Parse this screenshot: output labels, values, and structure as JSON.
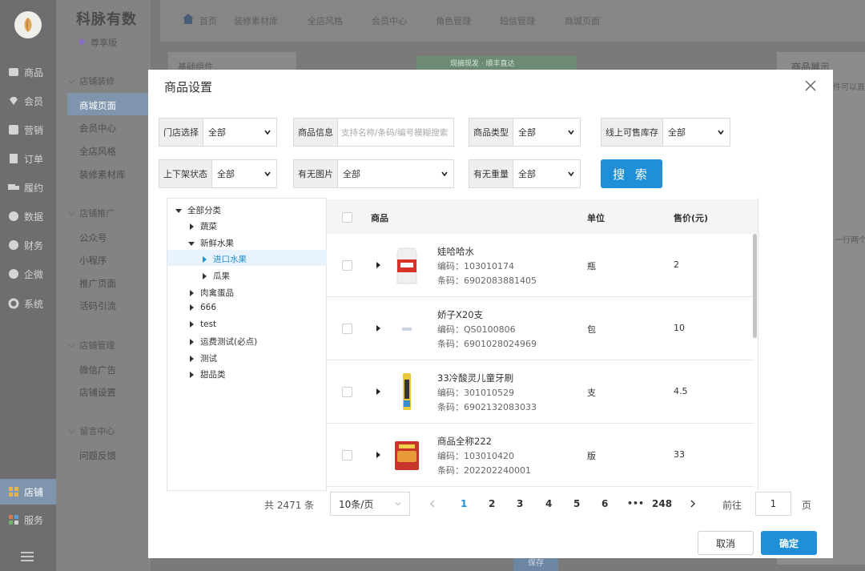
{
  "brand": {
    "name": "科脉有数",
    "edition": "尊享版"
  },
  "rail": {
    "items": [
      {
        "label": "商品",
        "icon": "goods-icon"
      },
      {
        "label": "会员",
        "icon": "member-icon"
      },
      {
        "label": "营销",
        "icon": "marketing-icon"
      },
      {
        "label": "订单",
        "icon": "order-icon"
      },
      {
        "label": "履约",
        "icon": "delivery-icon"
      },
      {
        "label": "数据",
        "icon": "data-icon"
      },
      {
        "label": "财务",
        "icon": "finance-icon"
      },
      {
        "label": "企微",
        "icon": "wecom-icon"
      },
      {
        "label": "系统",
        "icon": "system-icon"
      }
    ],
    "store": "店铺",
    "service": "服务"
  },
  "sidebar": {
    "sections": [
      {
        "title": "店铺装修",
        "items": [
          "商城页面",
          "会员中心",
          "全店风格",
          "装修素材库"
        ]
      },
      {
        "title": "店铺推广",
        "items": [
          "公众号",
          "小程序",
          "推广页面",
          "活码引流"
        ]
      },
      {
        "title": "店铺管理",
        "items": [
          "微信广告",
          "店铺设置"
        ]
      },
      {
        "title": "留言中心",
        "items": [
          "问题反馈"
        ]
      }
    ]
  },
  "topnav": {
    "home": "首页",
    "tabs": [
      "装修素材库",
      "全店风格",
      "会员中心",
      "角色管理",
      "短信管理",
      "商城页面"
    ]
  },
  "background": {
    "left_panel_title": "基础组件",
    "right_panel_title": "商品展示",
    "right_panel_hint": "件可以直接",
    "right_row_hint": "一行两个",
    "banner_text": "现摘现发 · 顺丰直达",
    "save": "保存"
  },
  "modal": {
    "title": "商品设置",
    "filters": {
      "store": {
        "label": "门店选择",
        "value": "全部"
      },
      "info": {
        "label": "商品信息",
        "placeholder": "支持名称/条码/编号模糊搜索"
      },
      "type": {
        "label": "商品类型",
        "value": "全部"
      },
      "stock": {
        "label": "线上可售库存",
        "value": "全部"
      },
      "shelf": {
        "label": "上下架状态",
        "value": "全部"
      },
      "image": {
        "label": "有无图片",
        "value": "全部"
      },
      "weight": {
        "label": "有无重量",
        "value": "全部"
      }
    },
    "search_label": "搜 索",
    "tree": {
      "root": "全部分类",
      "nodes": [
        {
          "label": "蔬菜",
          "level": 1,
          "state": "collapsed"
        },
        {
          "label": "新鲜水果",
          "level": 1,
          "state": "expanded"
        },
        {
          "label": "进口水果",
          "level": 2,
          "state": "collapsed",
          "selected": true
        },
        {
          "label": "瓜果",
          "level": 2,
          "state": "collapsed"
        },
        {
          "label": "肉禽蛋品",
          "level": 1,
          "state": "collapsed"
        },
        {
          "label": "666",
          "level": 1,
          "state": "collapsed"
        },
        {
          "label": "test",
          "level": 1,
          "state": "collapsed"
        },
        {
          "label": "运费测试(必点)",
          "level": 1,
          "state": "collapsed"
        },
        {
          "label": "测试",
          "level": 1,
          "state": "collapsed"
        },
        {
          "label": "甜品类",
          "level": 1,
          "state": "collapsed"
        }
      ]
    },
    "table": {
      "headers": {
        "product": "商品",
        "unit": "单位",
        "price": "售价(元)"
      },
      "rows": [
        {
          "name": "娃哈哈水",
          "code": "编码：103010174",
          "barcode": "条码：6902083881405",
          "unit": "瓶",
          "price": "2",
          "thumb": "water-bottle-image"
        },
        {
          "name": "娇子X20支",
          "code": "编码：QS0100806",
          "barcode": "条码：6901028024969",
          "unit": "包",
          "price": "10",
          "thumb": "cigarette-image"
        },
        {
          "name": "33冷酸灵儿童牙刷",
          "code": "编码：301010529",
          "barcode": "条码：6902132083033",
          "unit": "支",
          "price": "4.5",
          "thumb": "toothbrush-image"
        },
        {
          "name": "商品全称222",
          "code": "编码：103010420",
          "barcode": "条码：202202240001",
          "unit": "版",
          "price": "33",
          "thumb": "snack-bag-image"
        }
      ]
    },
    "pagination": {
      "total": "共 2471 条",
      "page_size": "10条/页",
      "pages": [
        "1",
        "2",
        "3",
        "4",
        "5",
        "6"
      ],
      "ellipsis": "•••",
      "last": "248",
      "current": "1",
      "goto": "前往",
      "goto_value": "1",
      "page_unit": "页"
    },
    "buttons": {
      "cancel": "取消",
      "confirm": "确定"
    }
  },
  "colors": {
    "primary": "#1f8fd7",
    "overlay": "#7a7a7a",
    "selected_tree": "#e8f3fd"
  }
}
